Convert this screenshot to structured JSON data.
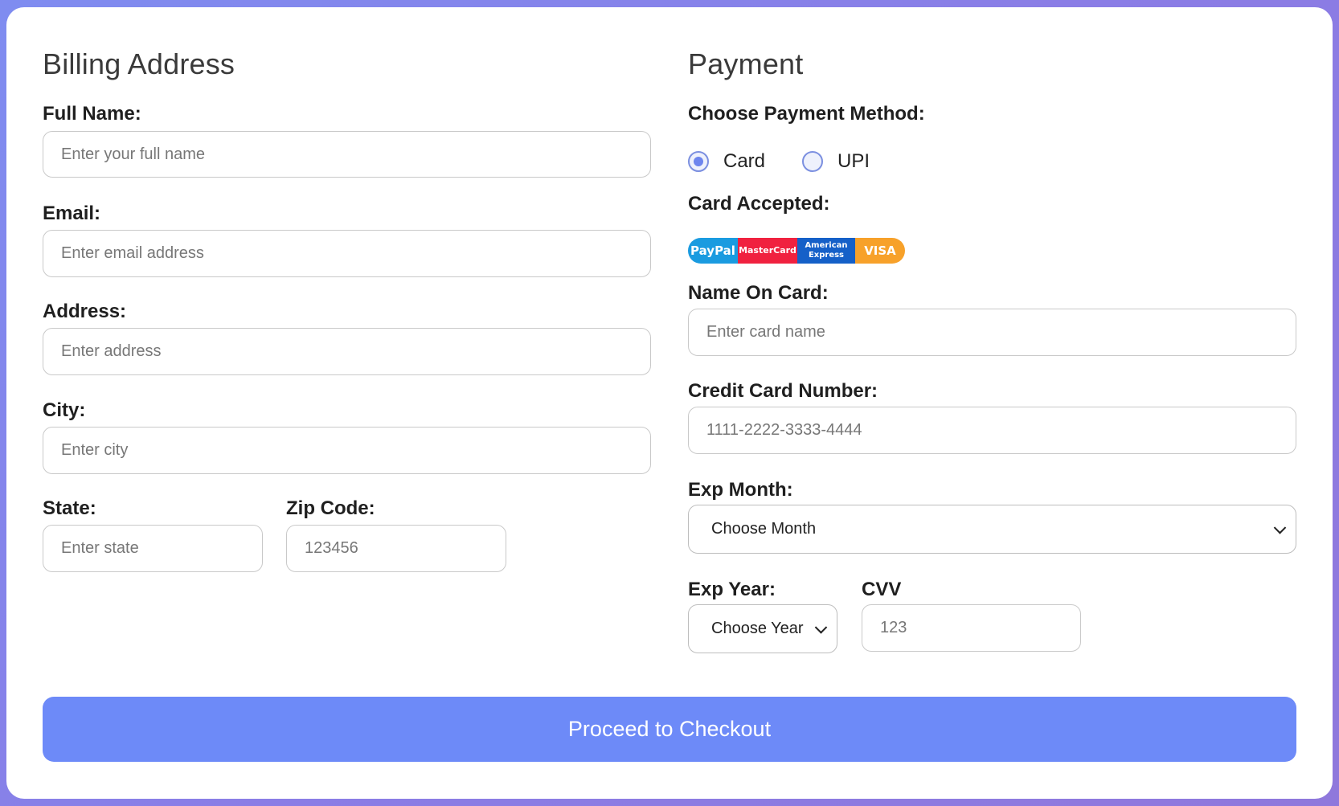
{
  "billing": {
    "title": "Billing Address",
    "full_name": {
      "label": "Full Name:",
      "placeholder": "Enter your full name"
    },
    "email": {
      "label": "Email:",
      "placeholder": "Enter email address"
    },
    "address": {
      "label": "Address:",
      "placeholder": "Enter address"
    },
    "city": {
      "label": "City:",
      "placeholder": "Enter city"
    },
    "state": {
      "label": "State:",
      "placeholder": "Enter state"
    },
    "zip": {
      "label": "Zip Code:",
      "placeholder": "123456"
    }
  },
  "payment": {
    "title": "Payment",
    "method_label": "Choose Payment Method:",
    "methods": [
      {
        "label": "Card",
        "selected": true
      },
      {
        "label": "UPI",
        "selected": false
      }
    ],
    "cards_label": "Card Accepted:",
    "card_brands": [
      "PayPal",
      "MasterCard",
      "American Express",
      "VISA"
    ],
    "card_brand_lines": {
      "amex_line1": "American",
      "amex_line2": "Express"
    },
    "name_on_card": {
      "label": "Name On Card:",
      "placeholder": "Enter card name"
    },
    "card_number": {
      "label": "Credit Card Number:",
      "placeholder": "1111-2222-3333-4444"
    },
    "exp_month": {
      "label": "Exp Month:",
      "selected": "Choose Month"
    },
    "exp_year": {
      "label": "Exp Year:",
      "selected": "Choose Year"
    },
    "cvv": {
      "label": "CVV",
      "placeholder": "123"
    }
  },
  "submit": {
    "label": "Proceed to Checkout"
  },
  "colors": {
    "accent": "#6d8af8",
    "background_gradient": [
      "#7f8cf0",
      "#8f78dc"
    ],
    "paypal": "#1a9be0",
    "mastercard": "#f0213f",
    "amex": "#1560c8",
    "visa": "#f7a12a"
  }
}
